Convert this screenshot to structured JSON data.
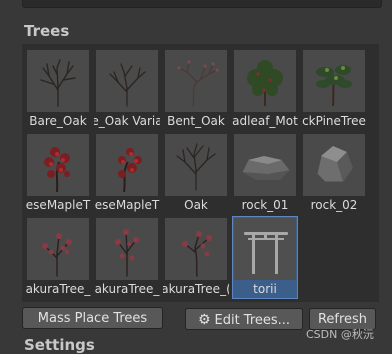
{
  "section_title": "Trees",
  "next_section_title": "Settings",
  "trees": [
    {
      "label": "Bare_Oak",
      "icon": "bare-tree"
    },
    {
      "label": "e_Oak Varia",
      "icon": "bare-tree"
    },
    {
      "label": "Bent_Oak",
      "icon": "bent-tree"
    },
    {
      "label": "adleaf_Mot",
      "icon": "leafy-tree"
    },
    {
      "label": "ckPineTree",
      "icon": "pine-tree"
    },
    {
      "label": "eseMapleT",
      "icon": "maple-tree"
    },
    {
      "label": "eseMapleT",
      "icon": "maple-tree"
    },
    {
      "label": "Oak",
      "icon": "bare-tree"
    },
    {
      "label": "rock_01",
      "icon": "rock"
    },
    {
      "label": "rock_02",
      "icon": "rock"
    },
    {
      "label": "akuraTree_",
      "icon": "sakura-tree"
    },
    {
      "label": "akuraTree_",
      "icon": "sakura-tree"
    },
    {
      "label": "akuraTree_(",
      "icon": "sakura-tree"
    },
    {
      "label": "torii",
      "icon": "torii-gate",
      "selected": true
    }
  ],
  "buttons": {
    "mass_place": "Mass Place Trees",
    "edit_trees": "Edit Trees...",
    "refresh": "Refresh"
  },
  "watermark": "CSDN @秋沅"
}
